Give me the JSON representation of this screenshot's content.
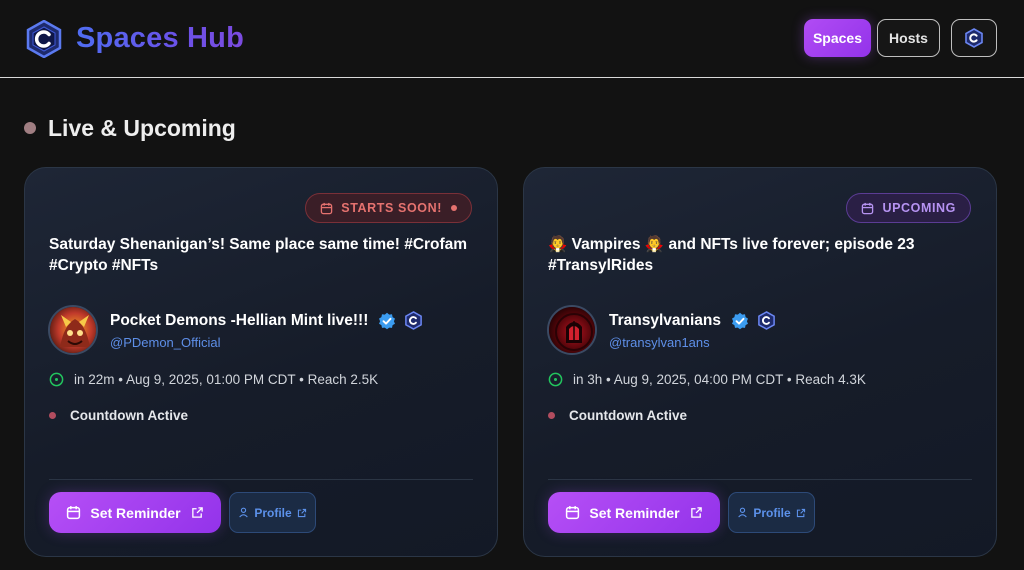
{
  "header": {
    "title": "Spaces Hub",
    "nav": {
      "spaces_label": "Spaces",
      "hosts_label": "Hosts"
    }
  },
  "section": {
    "title": "Live & Upcoming"
  },
  "cards": [
    {
      "badge": "STARTS SOON!",
      "title": "Saturday Shenanigan’s! Same place same time! #Crofam #Crypto #NFTs",
      "host_name": "Pocket Demons -Hellian Mint live!!!",
      "host_handle": "@PDemon_Official",
      "meta": "in 22m • Aug 9, 2025, 01:00 PM CDT • Reach 2.5K",
      "status": "Countdown Active",
      "reminder_label": "Set Reminder",
      "profile_label": "Profile"
    },
    {
      "badge": "UPCOMING",
      "title": "🧛 Vampires 🧛 and NFTs live forever; episode 23 #TransylRides",
      "host_name": "Transylvanians",
      "host_handle": "@transylvan1ans",
      "meta": "in 3h • Aug 9, 2025, 04:00 PM CDT • Reach 4.3K",
      "status": "Countdown Active",
      "reminder_label": "Set Reminder",
      "profile_label": "Profile"
    }
  ],
  "colors": {
    "accent": "#9333ea",
    "brand_blue": "#4f6df2",
    "soon_badge": "#e5726f",
    "upcoming_badge": "#b693f2",
    "handle": "#5e8fe8",
    "clock_green": "#22c55e"
  },
  "icons": {
    "logo": "hexagon-c-logo-icon",
    "verified": "verified-badge-icon",
    "calendar": "calendar-icon",
    "clock": "clock-icon",
    "external": "external-link-icon",
    "user": "user-icon"
  }
}
